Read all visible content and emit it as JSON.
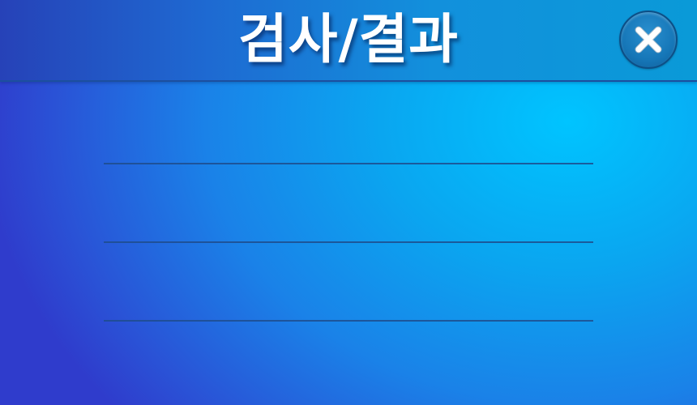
{
  "header": {
    "title": "검사/결과",
    "close_icon": "close-icon"
  },
  "result_rows": [
    {
      "text": ""
    },
    {
      "text": ""
    },
    {
      "text": ""
    }
  ],
  "colors": {
    "background_light": "#00c4ff",
    "background_dark": "#2f3ccc",
    "header": "#1a70d0",
    "title_text": "#ffffff",
    "close_button": "#1677b8",
    "divider": "#1f4c8c"
  }
}
